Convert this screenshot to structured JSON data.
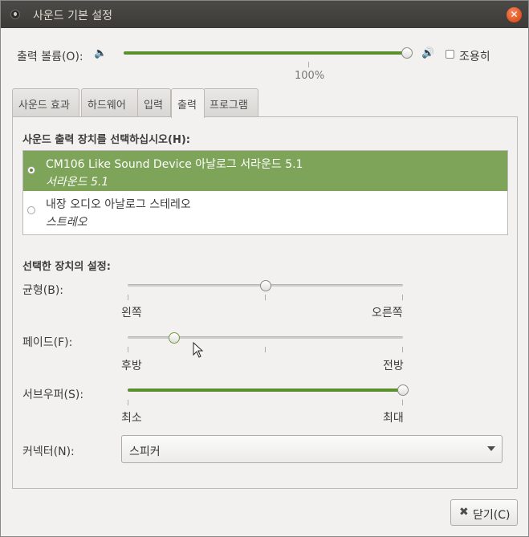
{
  "window": {
    "title": "사운드 기본 설정"
  },
  "output_volume": {
    "label": "출력 볼륨(O):",
    "value_percent": 100,
    "value_text": "100%",
    "mute_label": "조용히",
    "muted": false
  },
  "tabs": [
    {
      "label": "사운드 효과",
      "active": false
    },
    {
      "label": "하드웨어",
      "active": false
    },
    {
      "label": "입력",
      "active": false
    },
    {
      "label": "출력",
      "active": true
    },
    {
      "label": "프로그램",
      "active": false
    }
  ],
  "device_section": {
    "heading": "사운드 출력 장치를 선택하십시오(H):"
  },
  "devices": [
    {
      "name": "CM106 Like Sound Device 아날로그 서라운드 5.1",
      "profile": "서라운드 5.1",
      "selected": true
    },
    {
      "name": "내장 오디오 아날로그 스테레오",
      "profile": "스트레오",
      "selected": false
    }
  ],
  "settings_section": {
    "heading": "선택한 장치의 설정:"
  },
  "balance": {
    "label": "균형(B):",
    "left_label": "왼쪽",
    "right_label": "오른쪽",
    "value": 0.5
  },
  "fade": {
    "label": "페이드(F):",
    "left_label": "후방",
    "right_label": "전방",
    "value": 0.17
  },
  "subwoofer": {
    "label": "서브우퍼(S):",
    "left_label": "최소",
    "right_label": "최대",
    "value": 1.0
  },
  "connector": {
    "label": "커넥터(N):",
    "selected": "스피커"
  },
  "footer": {
    "close_label": "닫기(C)"
  },
  "colors": {
    "accent": "#7da458",
    "slider_fill": "#5a8f2e",
    "titlebar": "#3c3b37",
    "close": "#e0521e"
  }
}
